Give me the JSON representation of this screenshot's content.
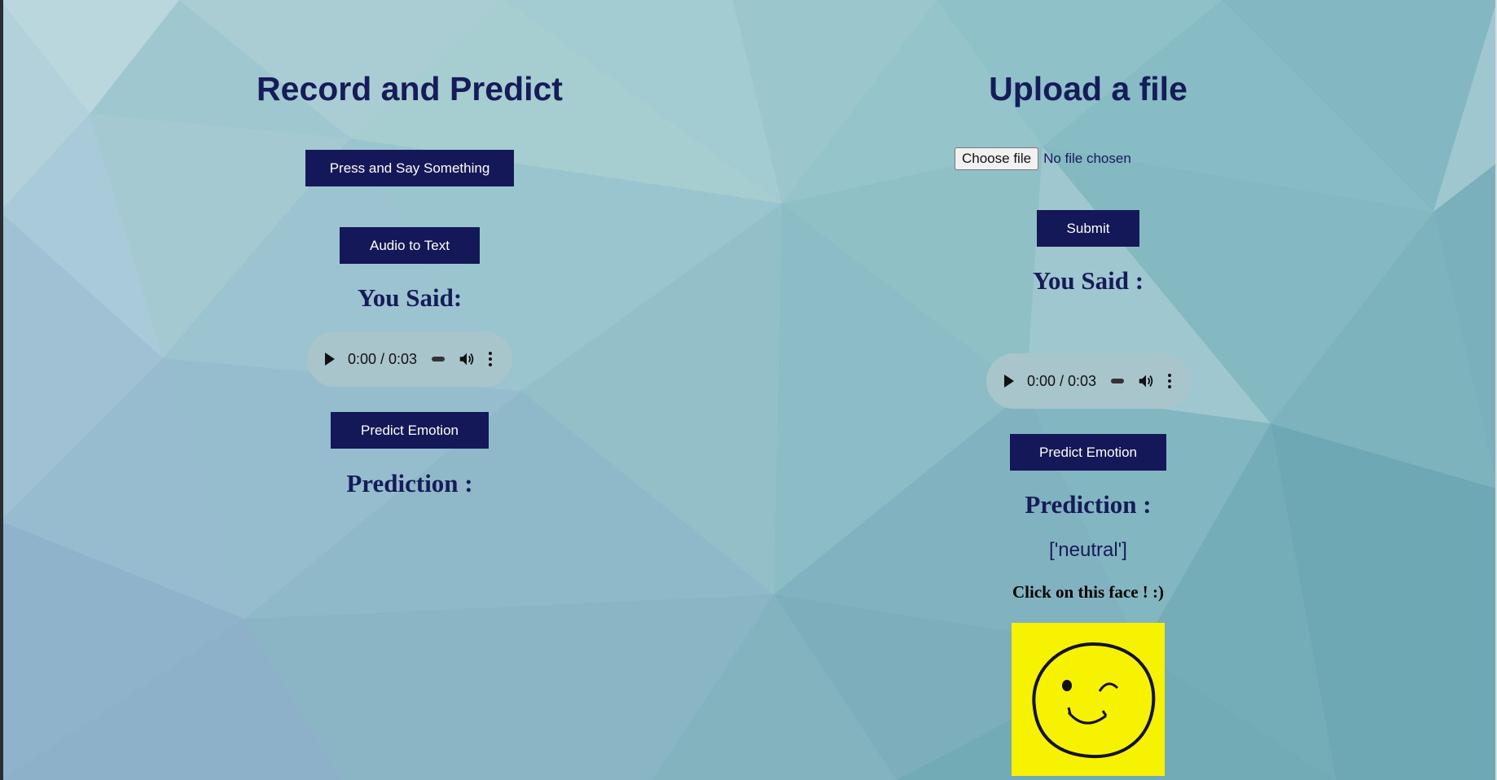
{
  "record": {
    "title": "Record and Predict",
    "press_button": "Press and Say Something",
    "audio_to_text_button": "Audio to Text",
    "you_said_label": "You Said:",
    "audio": {
      "time": "0:00 / 0:03"
    },
    "predict_button": "Predict Emotion",
    "prediction_label": "Prediction :"
  },
  "upload": {
    "title": "Upload a file",
    "choose_file_button": "Choose file",
    "file_status": "No file chosen",
    "submit_button": "Submit",
    "you_said_label": "You Said :",
    "audio": {
      "time": "0:00 / 0:03"
    },
    "predict_button": "Predict Emotion",
    "prediction_label": "Prediction :",
    "prediction_value": "['neutral']",
    "face_hint": "Click on this face ! :)"
  },
  "icons": {
    "play": "play-icon",
    "volume": "volume-icon",
    "more": "more-options-icon",
    "face": "winking-smiley-face-image"
  },
  "colors": {
    "heading": "#161b59",
    "button_bg": "#141858",
    "button_text": "#ffffff",
    "face_bg": "#f6f200"
  }
}
